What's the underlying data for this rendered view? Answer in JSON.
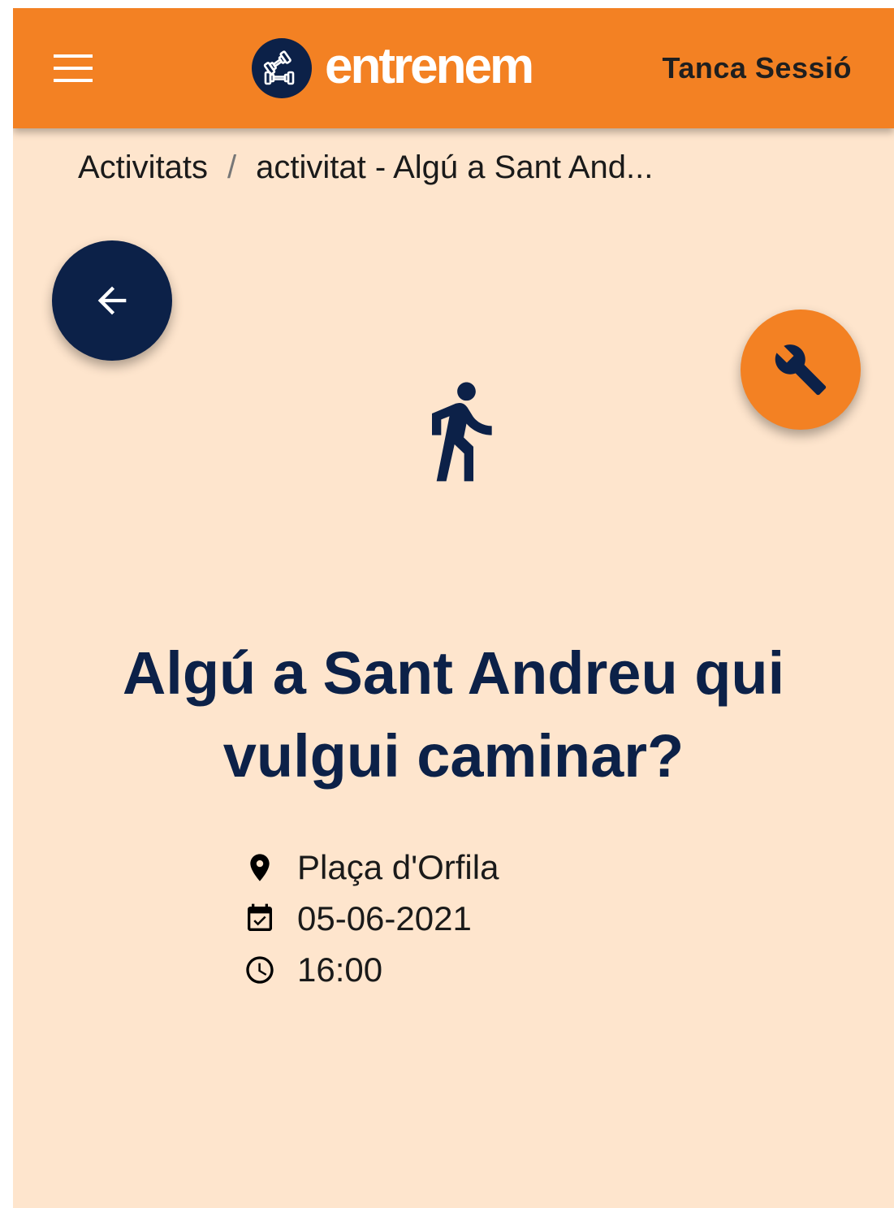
{
  "header": {
    "menu_icon": "hamburger-menu-icon",
    "logo_icon": "dumbbell-icon",
    "logo_text": "entrenem",
    "logout_label": "Tanca Sessió"
  },
  "breadcrumb": {
    "parent": "Activitats",
    "separator": "/",
    "current": "activitat - Algú a Sant And..."
  },
  "actions": {
    "back_icon": "arrow-left-icon",
    "edit_icon": "wrench-icon"
  },
  "activity": {
    "type_icon": "walking-person-icon",
    "title_line1": "Algú a Sant Andreu qui",
    "title_line2": "vulgui caminar?",
    "location": "Plaça d'Orfila",
    "date": "05-06-2021",
    "time": "16:00"
  },
  "colors": {
    "primary_orange": "#f38123",
    "navy": "#0c2148",
    "background": "#fee5cd"
  }
}
